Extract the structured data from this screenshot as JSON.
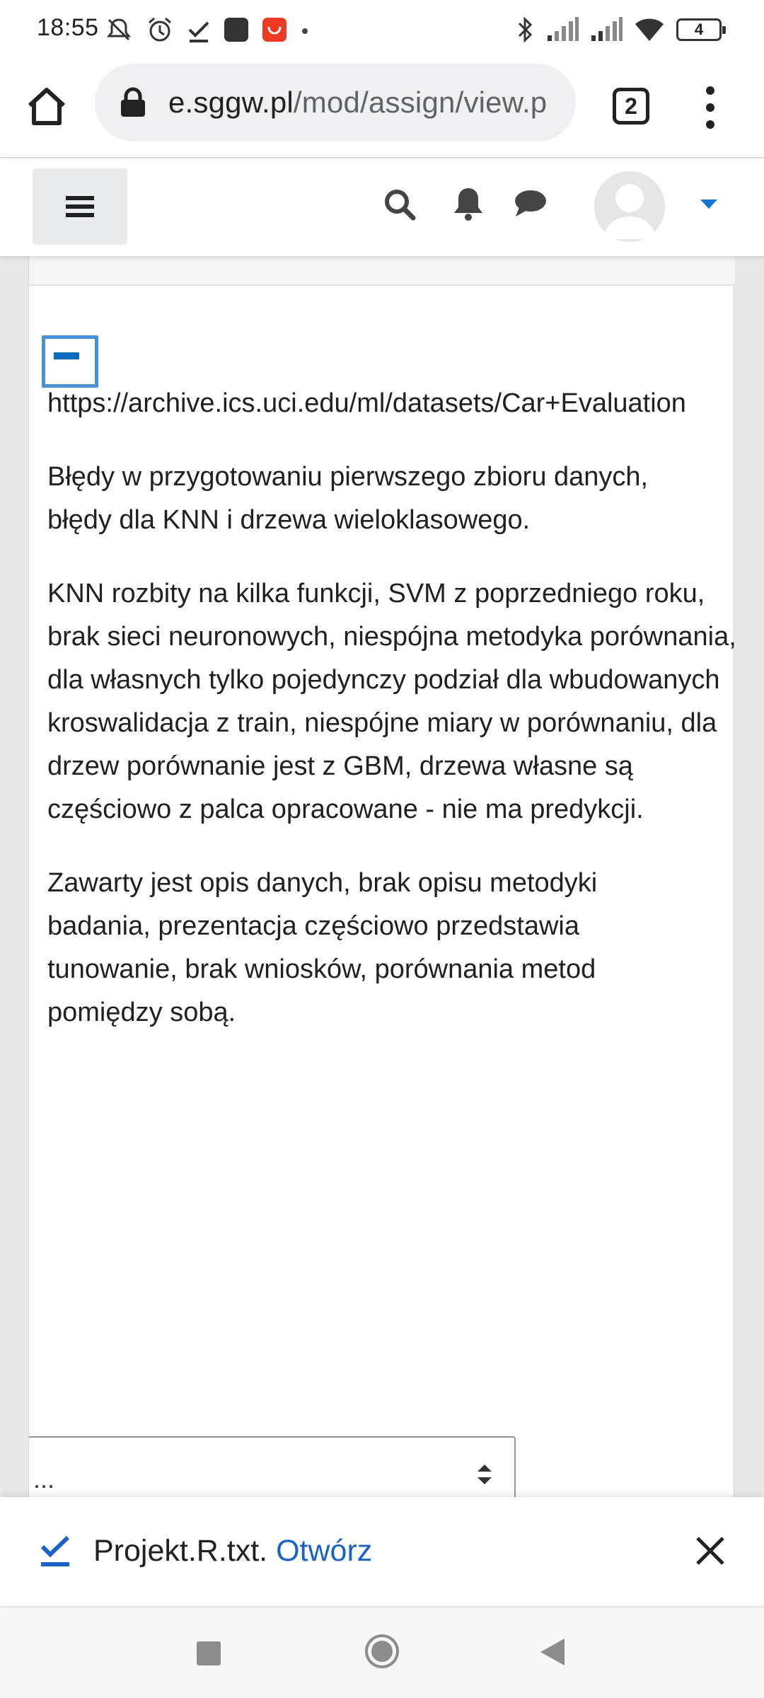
{
  "status_bar": {
    "time": "18:55",
    "battery": "4",
    "icons": [
      "muted-alarm-icon",
      "alarm-clock-icon",
      "check-icon",
      "app-square-icon",
      "shopping-app-icon",
      "dot-icon",
      "bluetooth-icon",
      "signal-icon",
      "signal-icon",
      "wifi-icon",
      "battery-icon"
    ]
  },
  "browser": {
    "url_host": "e.sggw.pl",
    "url_path": "/mod/assign/view.p",
    "tab_count": "2"
  },
  "moodle_nav": {
    "icons": [
      "menu-icon",
      "search-icon",
      "bell-icon",
      "chat-icon",
      "avatar",
      "caret-down-icon"
    ],
    "caret_color": "#1177d1"
  },
  "feedback": {
    "link": "https://archive.ics.uci.edu/ml/datasets/Car+Evaluation",
    "paragraph_1": "Błędy w przygotowaniu pierwszego zbioru danych, błędy dla KNN i drzewa wieloklasowego.",
    "paragraph_2": "KNN rozbity na kilka funkcji, SVM z poprzedniego roku, brak sieci neuronowych, niespójna metodyka porównania, dla własnych tylko pojedynczy podział dla wbudowanych kroswalidacja z train, niespójne miary w porównaniu, dla drzew porównanie jest z GBM, drzewa własne są częściowo z palca opracowane - nie ma predykcji.",
    "paragraph_3": "Zawarty jest opis danych, brak opisu metodyki badania, prezentacja częściowo przedstawia tunowanie, brak wniosków, porównania metod pomiędzy sobą."
  },
  "select": {
    "value": "..."
  },
  "download": {
    "filename": "Projekt.R.txt.",
    "open_label": "Otwórz",
    "link_color": "#1a62c5"
  }
}
